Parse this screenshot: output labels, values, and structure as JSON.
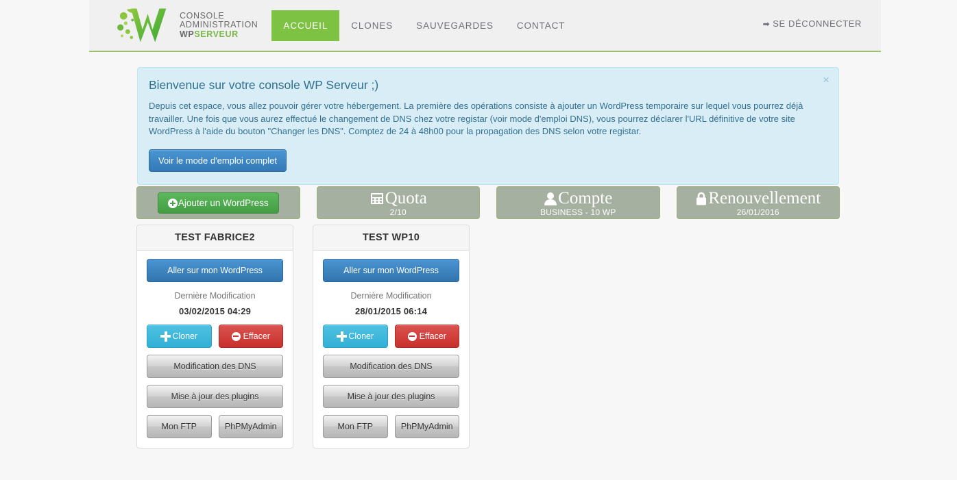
{
  "header": {
    "brand": {
      "line1": "CONSOLE",
      "line2": "ADMINISTRATION",
      "wp": "WP",
      "serveur": "SERVEUR",
      "logo_icon": "wpserveur-w-logo"
    },
    "nav": [
      {
        "label": "ACCUEIL",
        "active": true
      },
      {
        "label": "CLONES",
        "active": false
      },
      {
        "label": "SAUVEGARDES",
        "active": false
      },
      {
        "label": "CONTACT",
        "active": false
      }
    ],
    "logout": {
      "label": "SE DÉCONNECTER",
      "icon": "sign-out-icon"
    }
  },
  "alert": {
    "title": "Bienvenue sur votre console WP Serveur ;)",
    "body": "Depuis cet espace, vous allez pouvoir gérer votre hébergement. La première des opérations consiste à ajouter un WordPress temporaire sur lequel vous pourrez déjà travailler. Une fois que vous aurez effectué le changement de DNS chez votre registar (voir mode d'emploi DNS), vous pourrez déclarer l'URL définitive de votre site WordPress à l'aide du bouton \"Changer les DNS\". Comptez de 24 à 48h00 pour la propagation des DNS selon votre registar.",
    "button_label": "Voir le mode d'emploi complet",
    "close_label": "×",
    "bg_color": "#d9edf7",
    "text_color": "#31708f"
  },
  "stats": {
    "add_button": {
      "label": "Ajouter un WordPress",
      "icon": "plus-circle-icon"
    },
    "panels": [
      {
        "title": "Quota",
        "sub": "2/10",
        "icon": "th-grid-icon"
      },
      {
        "title": "Compte",
        "sub": "BUSINESS - 10 WP",
        "icon": "user-icon"
      },
      {
        "title": "Renouvellement",
        "sub": "26/01/2016",
        "icon": "lock-icon"
      }
    ],
    "panel_bg": "#a5b0a0",
    "panel_border": "#9cb177"
  },
  "cards": [
    {
      "title": "TEST FABRICE2",
      "go_label": "Aller sur mon WordPress",
      "meta_label": "Dernière Modification",
      "meta_value": "03/02/2015 04:29",
      "clone_label": "Cloner",
      "delete_label": "Effacer",
      "dns_label": "Modification des DNS",
      "plugins_label": "Mise à jour des plugins",
      "ftp_label": "Mon FTP",
      "phpmyadmin_label": "PhPMyAdmin"
    },
    {
      "title": "TEST WP10",
      "go_label": "Aller sur mon WordPress",
      "meta_label": "Dernière Modification",
      "meta_value": "28/01/2015 06:14",
      "clone_label": "Cloner",
      "delete_label": "Effacer",
      "dns_label": "Modification des DNS",
      "plugins_label": "Mise à jour des plugins",
      "ftp_label": "Mon FTP",
      "phpmyadmin_label": "PhPMyAdmin"
    }
  ]
}
